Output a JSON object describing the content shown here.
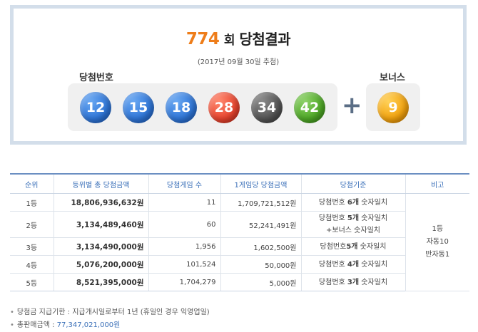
{
  "header": {
    "round_number": "774",
    "round_suffix": "회",
    "title_text": "당첨결과",
    "draw_date": "(2017년 09월 30일 추첨)"
  },
  "labels": {
    "winning_numbers": "당첨번호",
    "bonus": "보너스",
    "plus": "+"
  },
  "balls": [
    {
      "value": "12",
      "color": "#2f76d8"
    },
    {
      "value": "15",
      "color": "#2f76d8"
    },
    {
      "value": "18",
      "color": "#2f76d8"
    },
    {
      "value": "28",
      "color": "#e8442e"
    },
    {
      "value": "34",
      "color": "#555555"
    },
    {
      "value": "42",
      "color": "#4ea826"
    }
  ],
  "bonus_ball": {
    "value": "9",
    "color": "#f2a20e"
  },
  "table": {
    "headers": [
      "순위",
      "등위별 총 당첨금액",
      "당첨게임 수",
      "1게임당 당첨금액",
      "당첨기준",
      "비고"
    ],
    "rows": [
      {
        "rank": "1등",
        "total": "18,806,936,632원",
        "count": "11",
        "per_game": "1,709,721,512원",
        "crit_pre": "당첨번호 ",
        "crit_bold": "6개",
        "crit_post": " 숫자일치",
        "crit2": ""
      },
      {
        "rank": "2등",
        "total": "3,134,489,460원",
        "count": "60",
        "per_game": "52,241,491원",
        "crit_pre": "당첨번호 ",
        "crit_bold": "5개",
        "crit_post": " 숫자일치",
        "crit2": "+보너스 숫자일치"
      },
      {
        "rank": "3등",
        "total": "3,134,490,000원",
        "count": "1,956",
        "per_game": "1,602,500원",
        "crit_pre": "당첨번호",
        "crit_bold": "5개",
        "crit_post": " 숫자일치",
        "crit2": ""
      },
      {
        "rank": "4등",
        "total": "5,076,200,000원",
        "count": "101,524",
        "per_game": "50,000원",
        "crit_pre": "당첨번호 ",
        "crit_bold": "4개",
        "crit_post": " 숫자일치",
        "crit2": ""
      },
      {
        "rank": "5등",
        "total": "8,521,395,000원",
        "count": "1,704,279",
        "per_game": "5,000원",
        "crit_pre": "당첨번호 ",
        "crit_bold": "3개",
        "crit_post": " 숫자일치",
        "crit2": ""
      }
    ],
    "note_lines": [
      "1등",
      "자동10",
      "반자동1"
    ]
  },
  "notes": {
    "bullet": "•",
    "deadline": "당첨금 지급기한 : 지급개시일로부터 1년 (휴일인 경우 익영업일)",
    "total_sales_label": "총판매금액 : ",
    "total_sales_value": "77,347,021,000원"
  }
}
